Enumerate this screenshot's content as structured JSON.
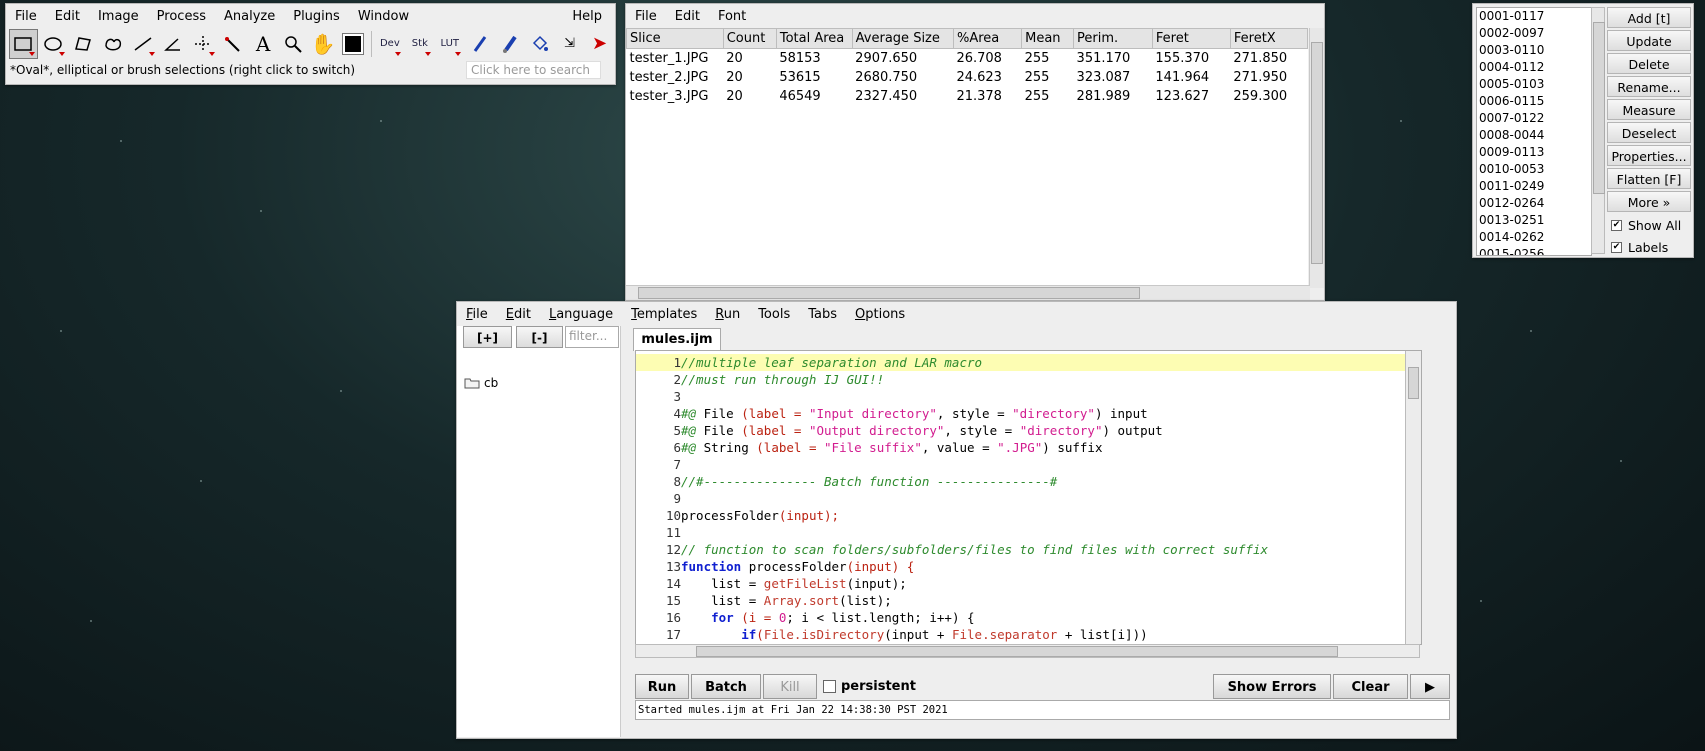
{
  "imagej": {
    "menu": [
      "File",
      "Edit",
      "Image",
      "Process",
      "Analyze",
      "Plugins",
      "Window",
      "Help"
    ],
    "tools": {
      "dev": "Dev",
      "stk": "Stk",
      "lut": "LUT"
    },
    "status": "*Oval*, elliptical or brush selections (right click to switch)",
    "search_placeholder": "Click here to search"
  },
  "results": {
    "menu": [
      "File",
      "Edit",
      "Font"
    ],
    "columns": [
      "Slice",
      "Count",
      "Total Area",
      "Average Size",
      "%Area",
      "Mean",
      "Perim.",
      "Feret",
      "FeretX"
    ],
    "rows": [
      [
        "tester_1.JPG",
        "20",
        "58153",
        "2907.650",
        "26.708",
        "255",
        "351.170",
        "155.370",
        "271.850"
      ],
      [
        "tester_2.JPG",
        "20",
        "53615",
        "2680.750",
        "24.623",
        "255",
        "323.087",
        "141.964",
        "271.950"
      ],
      [
        "tester_3.JPG",
        "20",
        "46549",
        "2327.450",
        "21.378",
        "255",
        "281.989",
        "123.627",
        "259.300"
      ]
    ]
  },
  "roi_manager": {
    "items": [
      "0001-0117",
      "0002-0097",
      "0003-0110",
      "0004-0112",
      "0005-0103",
      "0006-0115",
      "0007-0122",
      "0008-0044",
      "0009-0113",
      "0010-0053",
      "0011-0249",
      "0012-0264",
      "0013-0251",
      "0014-0262",
      "0015-0256"
    ],
    "buttons": [
      "Add [t]",
      "Update",
      "Delete",
      "Rename...",
      "Measure",
      "Deselect",
      "Properties...",
      "Flatten [F]",
      "More »"
    ],
    "show_all": "Show All",
    "labels": "Labels"
  },
  "editor": {
    "menu": [
      "File",
      "Edit",
      "Language",
      "Templates",
      "Run",
      "Tools",
      "Tabs",
      "Options"
    ],
    "expand": "[+]",
    "collapse": "[-]",
    "filter_placeholder": "filter...",
    "folder": "cb",
    "tab": "mules.ijm",
    "line_numbers": [
      "1",
      "2",
      "3",
      "4",
      "5",
      "6",
      "7",
      "8",
      "9",
      "10",
      "11",
      "12",
      "13",
      "14",
      "15",
      "16",
      "17"
    ],
    "code": {
      "l1": "//multiple leaf separation and LAR macro",
      "l2": "//must run through IJ GUI!!",
      "l4a": "#@",
      "l4b": " File ",
      "l4c": "(label = ",
      "l4d": "\"Input directory\"",
      "l4e": ", style = ",
      "l4f": "\"directory\"",
      "l4g": ") input",
      "l5a": "#@",
      "l5b": " File ",
      "l5c": "(label = ",
      "l5d": "\"Output directory\"",
      "l5e": ", style = ",
      "l5f": "\"directory\"",
      "l5g": ") output",
      "l6a": "#@",
      "l6b": " String ",
      "l6c": "(label = ",
      "l6d": "\"File suffix\"",
      "l6e": ", value = ",
      "l6f": "\".JPG\"",
      "l6g": ") suffix",
      "l8": "//#--------------- Batch function ---------------#",
      "l10a": "processFolder",
      "l10b": "(input);",
      "l12": "// function to scan folders/subfolders/files to find files with correct suffix",
      "l13a": "function",
      "l13b": " processFolder",
      "l13c": "(input) {",
      "l14a": "    list = ",
      "l14b": "getFileList",
      "l14c": "(input);",
      "l15a": "    list = ",
      "l15b": "Array.sort",
      "l15c": "(list);",
      "l16a": "    ",
      "l16b": "for",
      "l16c": " (i = ",
      "l16d": "0",
      "l16e": "; i < list.length; i++) {",
      "l17a": "        ",
      "l17b": "if",
      "l17c": "(",
      "l17d": "File.isDirectory",
      "l17e": "(input + ",
      "l17f": "File.separator",
      "l17g": " + list[i]))"
    },
    "run": "Run",
    "batch": "Batch",
    "kill": "Kill",
    "persistent": "persistent",
    "show_errors": "Show Errors",
    "clear": "Clear",
    "more": "▶",
    "log": "Started mules.ijm at Fri Jan 22 14:38:30 PST 2021"
  }
}
